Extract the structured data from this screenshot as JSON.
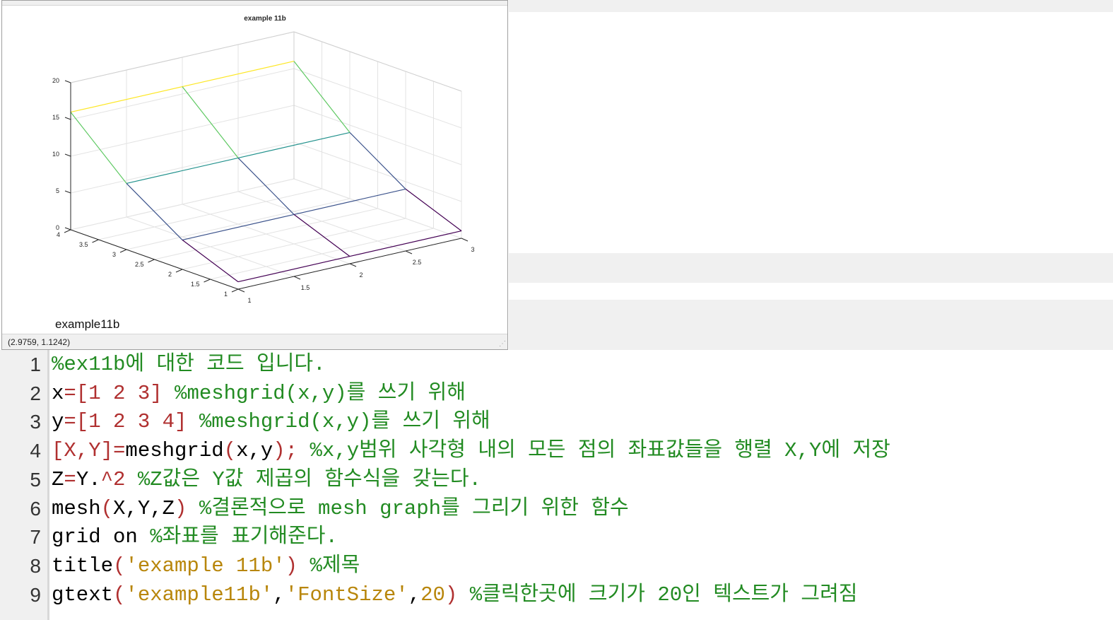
{
  "figure": {
    "name": "example11b",
    "title": "example 11b",
    "status": "(2.9759, 1.1242)",
    "gtext": "example11b"
  },
  "chart_data": {
    "type": "mesh",
    "title": "example 11b",
    "x": [
      1,
      2,
      3
    ],
    "y": [
      1,
      2,
      3,
      4
    ],
    "z": [
      [
        1,
        1,
        1
      ],
      [
        4,
        4,
        4
      ],
      [
        9,
        9,
        9
      ],
      [
        16,
        16,
        16
      ]
    ],
    "xlim": [
      1,
      3
    ],
    "ylim": [
      1,
      4
    ],
    "zlim": [
      0,
      20
    ],
    "x_ticks": [
      "1",
      "1.5",
      "2",
      "2.5",
      "3"
    ],
    "y_ticks": [
      "1",
      "1.5",
      "2",
      "2.5",
      "3",
      "3.5",
      "4"
    ],
    "z_ticks": [
      "0",
      "5",
      "10",
      "15",
      "20"
    ],
    "grid": true,
    "colormap": [
      "#440154",
      "#3b528b",
      "#21918c",
      "#5ec962",
      "#fde725"
    ]
  },
  "editor": {
    "lines": [
      {
        "num": "1",
        "parts": [
          {
            "t": "%ex11b에 대한 코드 입니다.",
            "c": "c"
          }
        ]
      },
      {
        "num": "2",
        "parts": [
          {
            "t": "x",
            "c": "k"
          },
          {
            "t": "=[1 2 3]",
            "c": "o"
          },
          {
            "t": " %meshgrid(x,y)를 쓰기 위해",
            "c": "c"
          }
        ]
      },
      {
        "num": "3",
        "parts": [
          {
            "t": "y",
            "c": "k"
          },
          {
            "t": "=[1 2 3 4]",
            "c": "o"
          },
          {
            "t": " %meshgrid(x,y)를 쓰기 위해",
            "c": "c"
          }
        ]
      },
      {
        "num": "4",
        "parts": [
          {
            "t": "[X,Y]",
            "c": "o"
          },
          {
            "t": "=",
            "c": "o"
          },
          {
            "t": "meshgrid",
            "c": "k"
          },
          {
            "t": "(",
            "c": "o"
          },
          {
            "t": "x,y",
            "c": "k"
          },
          {
            "t": ");",
            "c": "o"
          },
          {
            "t": " %x,y범위 사각형 내의 모든 점의 좌표값들을 행렬 X,Y에 저장",
            "c": "c"
          }
        ]
      },
      {
        "num": "5",
        "parts": [
          {
            "t": "Z",
            "c": "k"
          },
          {
            "t": "=",
            "c": "o"
          },
          {
            "t": "Y.",
            "c": "k"
          },
          {
            "t": "^2",
            "c": "o"
          },
          {
            "t": " %Z값은 Y값 제곱의 함수식을 갖는다.",
            "c": "c"
          }
        ]
      },
      {
        "num": "6",
        "parts": [
          {
            "t": "mesh",
            "c": "k"
          },
          {
            "t": "(",
            "c": "o"
          },
          {
            "t": "X,Y,Z",
            "c": "k"
          },
          {
            "t": ")",
            "c": "o"
          },
          {
            "t": " %결론적으로 mesh graph를 그리기 위한 함수",
            "c": "c"
          }
        ]
      },
      {
        "num": "7",
        "parts": [
          {
            "t": "grid on",
            "c": "k"
          },
          {
            "t": " %좌표를 표기해준다.",
            "c": "c"
          }
        ]
      },
      {
        "num": "8",
        "parts": [
          {
            "t": "title",
            "c": "k"
          },
          {
            "t": "(",
            "c": "o"
          },
          {
            "t": "'example 11b'",
            "c": "s"
          },
          {
            "t": ")",
            "c": "o"
          },
          {
            "t": " %제목",
            "c": "c"
          }
        ]
      },
      {
        "num": "9",
        "parts": [
          {
            "t": "gtext",
            "c": "k"
          },
          {
            "t": "(",
            "c": "o"
          },
          {
            "t": "'example11b'",
            "c": "s"
          },
          {
            "t": ",",
            "c": "k"
          },
          {
            "t": "'FontSize'",
            "c": "s"
          },
          {
            "t": ",",
            "c": "k"
          },
          {
            "t": "20",
            "c": "s"
          },
          {
            "t": ")",
            "c": "o"
          },
          {
            "t": " %클릭한곳에 크기가 20인 텍스트가 그려짐",
            "c": "c"
          }
        ]
      }
    ]
  }
}
